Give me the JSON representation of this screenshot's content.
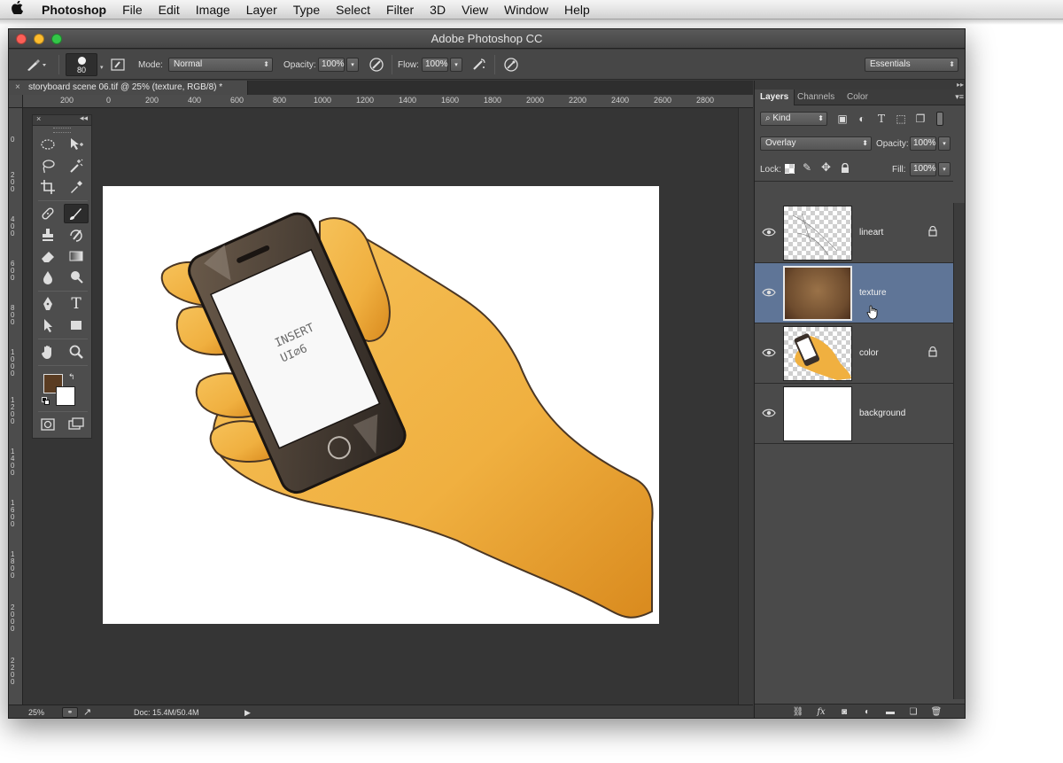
{
  "menubar": {
    "app": "Photoshop",
    "items": [
      "File",
      "Edit",
      "Image",
      "Layer",
      "Type",
      "Select",
      "Filter",
      "3D",
      "View",
      "Window",
      "Help"
    ]
  },
  "window": {
    "title": "Adobe Photoshop CC"
  },
  "options": {
    "brush_size": "80",
    "mode_label": "Mode:",
    "mode_value": "Normal",
    "opacity_label": "Opacity:",
    "opacity_value": "100%",
    "flow_label": "Flow:",
    "flow_value": "100%",
    "workspace": "Essentials"
  },
  "document": {
    "tab_title": "storyboard scene 06.tif @ 25% (texture, RGB/8) *",
    "ruler_top": [
      "200",
      "0",
      "200",
      "400",
      "600",
      "800",
      "1000",
      "1200",
      "1400",
      "1600",
      "1800",
      "2000",
      "2200",
      "2400",
      "2600",
      "2800"
    ],
    "ruler_left": [
      "0",
      "200",
      "400",
      "600",
      "800",
      "1000",
      "1200",
      "1400",
      "1600",
      "1800",
      "2000",
      "2200"
    ],
    "artwork_text_line1": "INSERT",
    "artwork_text_line2": "UI∅6"
  },
  "status": {
    "zoom": "25%",
    "doc": "Doc: 15.4M/50.4M"
  },
  "layers_panel": {
    "tabs": [
      "Layers",
      "Channels",
      "Color"
    ],
    "filter_kind": "Kind",
    "blend_mode": "Overlay",
    "opacity_label": "Opacity:",
    "opacity_value": "100%",
    "lock_label": "Lock:",
    "fill_label": "Fill:",
    "fill_value": "100%",
    "layers": [
      {
        "name": "lineart",
        "locked": true,
        "selected": false
      },
      {
        "name": "texture",
        "locked": false,
        "selected": true
      },
      {
        "name": "color",
        "locked": true,
        "selected": false
      },
      {
        "name": "background",
        "locked": false,
        "selected": false
      }
    ]
  },
  "colors": {
    "foreground": "#5a3c22",
    "background": "#ffffff",
    "selection": "#5f7597"
  }
}
